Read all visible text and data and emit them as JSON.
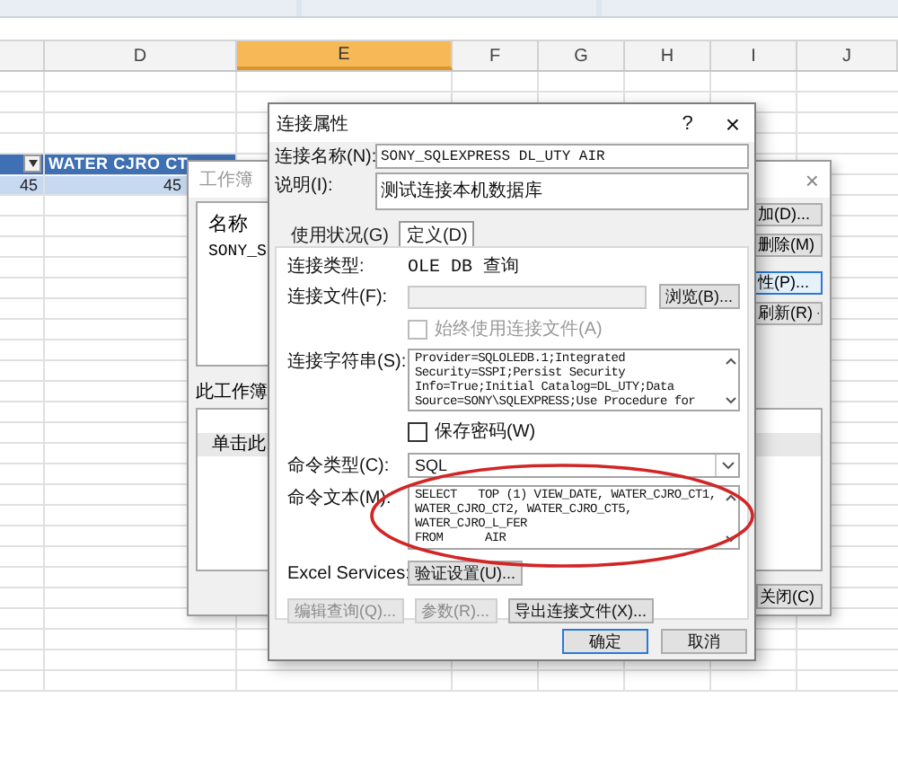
{
  "sheet": {
    "columns": [
      {
        "label": "D",
        "selected": false
      },
      {
        "label": "E",
        "selected": true
      },
      {
        "label": "F",
        "selected": false
      },
      {
        "label": "G",
        "selected": false
      },
      {
        "label": "H",
        "selected": false
      },
      {
        "label": "I",
        "selected": false
      },
      {
        "label": "J",
        "selected": false
      }
    ],
    "table": {
      "header_cells": [
        {
          "kind": "filter"
        },
        {
          "kind": "text",
          "text": "WATER CJRO CT"
        }
      ],
      "rows": [
        [
          "45",
          "45"
        ]
      ]
    }
  },
  "connections_dialog": {
    "title": "工作簿",
    "close": "×",
    "list_header": "名称",
    "list_items": [
      "SONY_S"
    ],
    "section_label": "此工作簿",
    "hint": "单击此",
    "buttons": [
      {
        "label": "加(D)...",
        "kind": "plain",
        "focused": false
      },
      {
        "label": "删除(M)",
        "kind": "plain",
        "focused": false
      },
      {
        "label": "性(P)...",
        "kind": "plain",
        "focused": true
      },
      {
        "label": "刷新(R)",
        "kind": "split",
        "focused": false
      }
    ],
    "close_button": "关闭(C)"
  },
  "properties_dialog": {
    "title": "连接属性",
    "help": "?",
    "close": "×",
    "name": {
      "label": "连接名称(N):",
      "value": "SONY_SQLEXPRESS DL_UTY AIR"
    },
    "description": {
      "label": "说明(I):",
      "value": "测试连接本机数据库"
    },
    "tabs": [
      {
        "label": "使用状况(G)",
        "selected": false
      },
      {
        "label": "定义(D)",
        "selected": true
      }
    ],
    "definition": {
      "connection_type": {
        "label": "连接类型:",
        "value": "OLE DB 查询"
      },
      "connection_file": {
        "label": "连接文件(F):",
        "disabled": true,
        "browse": "浏览(B)..."
      },
      "always_use_file": {
        "label": "始终使用连接文件(A)",
        "checked": false,
        "disabled": true
      },
      "connection_string": {
        "label": "连接字符串(S):",
        "lines": [
          "Provider=SQLOLEDB.1;Integrated",
          "Security=SSPI;Persist Security",
          "Info=True;Initial Catalog=DL_UTY;Data",
          "Source=SONY\\SQLEXPRESS;Use Procedure for"
        ]
      },
      "save_password": {
        "label": "保存密码(W)",
        "checked": false,
        "disabled": false
      },
      "command_type": {
        "label": "命令类型(C):",
        "value": "SQL"
      },
      "command_text": {
        "label": "命令文本(M):",
        "lines": [
          "SELECT   TOP (1) VIEW_DATE, WATER_CJRO_CT1,",
          "WATER_CJRO_CT2, WATER_CJRO_CT5,",
          "WATER_CJRO_L_FER",
          "FROM      AIR"
        ]
      },
      "excel_services": {
        "label": "Excel Services:",
        "button": "验证设置(U)..."
      },
      "actions": [
        {
          "label": "编辑查询(Q)...",
          "disabled": true
        },
        {
          "label": "参数(R)...",
          "disabled": true
        },
        {
          "label": "导出连接文件(X)...",
          "disabled": false
        }
      ]
    },
    "buttons": [
      {
        "label": "确定",
        "default": true
      },
      {
        "label": "取消",
        "default": false
      }
    ],
    "annotations": [
      {
        "kind": "ellipse"
      }
    ]
  }
}
